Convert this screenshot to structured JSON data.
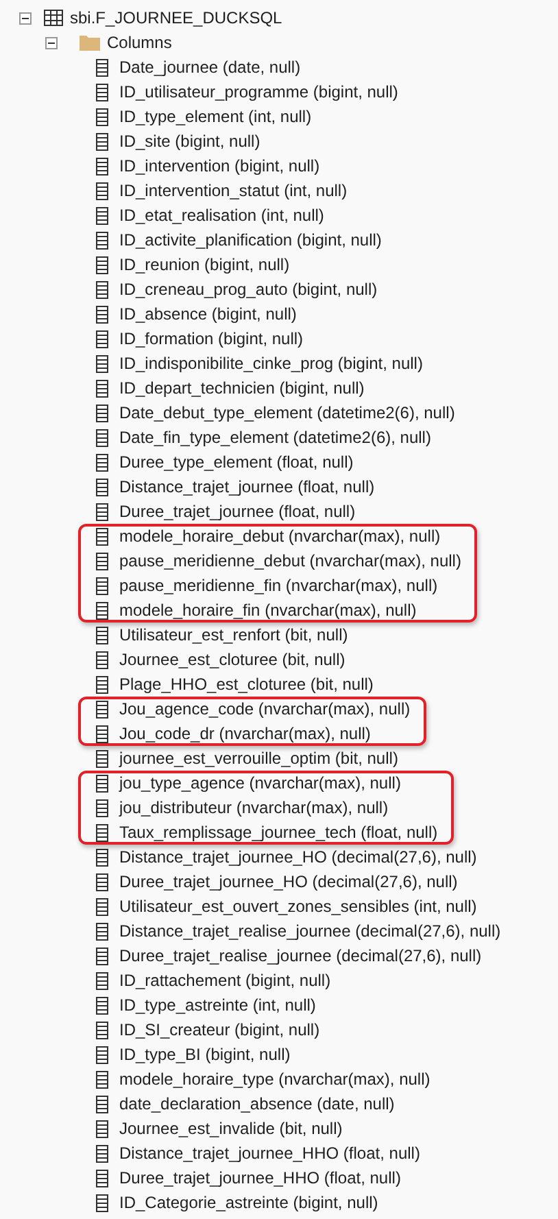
{
  "tree": [
    {
      "label": "sbi.F_JOURNEE_DUCKSQL",
      "kind": "table",
      "expanded": true,
      "children": [
        {
          "label": "Columns",
          "kind": "folder",
          "expanded": true,
          "children": [
            {
              "label": "Date_journee (date, null)",
              "kind": "column",
              "highlighted": false
            },
            {
              "label": "ID_utilisateur_programme (bigint, null)",
              "kind": "column",
              "highlighted": false
            },
            {
              "label": "ID_type_element (int, null)",
              "kind": "column",
              "highlighted": false
            },
            {
              "label": "ID_site (bigint, null)",
              "kind": "column",
              "highlighted": false
            },
            {
              "label": "ID_intervention (bigint, null)",
              "kind": "column",
              "highlighted": false
            },
            {
              "label": "ID_intervention_statut (int, null)",
              "kind": "column",
              "highlighted": false
            },
            {
              "label": "ID_etat_realisation (int, null)",
              "kind": "column",
              "highlighted": false
            },
            {
              "label": "ID_activite_planification (bigint, null)",
              "kind": "column",
              "highlighted": false
            },
            {
              "label": "ID_reunion (bigint, null)",
              "kind": "column",
              "highlighted": false
            },
            {
              "label": "ID_creneau_prog_auto (bigint, null)",
              "kind": "column",
              "highlighted": false
            },
            {
              "label": "ID_absence (bigint, null)",
              "kind": "column",
              "highlighted": false
            },
            {
              "label": "ID_formation (bigint, null)",
              "kind": "column",
              "highlighted": false
            },
            {
              "label": "ID_indisponibilite_cinke_prog (bigint, null)",
              "kind": "column",
              "highlighted": false
            },
            {
              "label": "ID_depart_technicien (bigint, null)",
              "kind": "column",
              "highlighted": false
            },
            {
              "label": "Date_debut_type_element (datetime2(6), null)",
              "kind": "column",
              "highlighted": false
            },
            {
              "label": "Date_fin_type_element (datetime2(6), null)",
              "kind": "column",
              "highlighted": false
            },
            {
              "label": "Duree_type_element (float, null)",
              "kind": "column",
              "highlighted": false
            },
            {
              "label": "Distance_trajet_journee (float, null)",
              "kind": "column",
              "highlighted": false
            },
            {
              "label": "Duree_trajet_journee (float, null)",
              "kind": "column",
              "highlighted": false
            },
            {
              "label": "modele_horaire_debut (nvarchar(max), null)",
              "kind": "column",
              "highlighted": true
            },
            {
              "label": "pause_meridienne_debut (nvarchar(max), null)",
              "kind": "column",
              "highlighted": true
            },
            {
              "label": "pause_meridienne_fin (nvarchar(max), null)",
              "kind": "column",
              "highlighted": true
            },
            {
              "label": "modele_horaire_fin (nvarchar(max), null)",
              "kind": "column",
              "highlighted": true
            },
            {
              "label": "Utilisateur_est_renfort (bit, null)",
              "kind": "column",
              "highlighted": false
            },
            {
              "label": "Journee_est_cloturee (bit, null)",
              "kind": "column",
              "highlighted": false
            },
            {
              "label": "Plage_HHO_est_cloturee (bit, null)",
              "kind": "column",
              "highlighted": false
            },
            {
              "label": "Jou_agence_code (nvarchar(max), null)",
              "kind": "column",
              "highlighted": true
            },
            {
              "label": "Jou_code_dr (nvarchar(max), null)",
              "kind": "column",
              "highlighted": true
            },
            {
              "label": "journee_est_verrouille_optim (bit, null)",
              "kind": "column",
              "highlighted": false
            },
            {
              "label": "jou_type_agence (nvarchar(max), null)",
              "kind": "column",
              "highlighted": true
            },
            {
              "label": "jou_distributeur (nvarchar(max), null)",
              "kind": "column",
              "highlighted": true
            },
            {
              "label": "Taux_remplissage_journee_tech (float, null)",
              "kind": "column",
              "highlighted": true
            },
            {
              "label": "Distance_trajet_journee_HO (decimal(27,6), null)",
              "kind": "column",
              "highlighted": false
            },
            {
              "label": "Duree_trajet_journee_HO (decimal(27,6), null)",
              "kind": "column",
              "highlighted": false
            },
            {
              "label": "Utilisateur_est_ouvert_zones_sensibles (int, null)",
              "kind": "column",
              "highlighted": false
            },
            {
              "label": "Distance_trajet_realise_journee (decimal(27,6), null)",
              "kind": "column",
              "highlighted": false
            },
            {
              "label": "Duree_trajet_realise_journee (decimal(27,6), null)",
              "kind": "column",
              "highlighted": false
            },
            {
              "label": "ID_rattachement (bigint, null)",
              "kind": "column",
              "highlighted": false
            },
            {
              "label": "ID_type_astreinte (int, null)",
              "kind": "column",
              "highlighted": false
            },
            {
              "label": "ID_SI_createur (bigint, null)",
              "kind": "column",
              "highlighted": false
            },
            {
              "label": "ID_type_BI (bigint, null)",
              "kind": "column",
              "highlighted": false
            },
            {
              "label": "modele_horaire_type (nvarchar(max), null)",
              "kind": "column",
              "highlighted": false
            },
            {
              "label": "date_declaration_absence (date, null)",
              "kind": "column",
              "highlighted": false
            },
            {
              "label": "Journee_est_invalide (bit, null)",
              "kind": "column",
              "highlighted": false
            },
            {
              "label": "Distance_trajet_journee_HHO (float, null)",
              "kind": "column",
              "highlighted": false
            },
            {
              "label": "Duree_trajet_journee_HHO (float, null)",
              "kind": "column",
              "highlighted": false
            },
            {
              "label": "ID_Categorie_astreinte (bigint, null)",
              "kind": "column",
              "highlighted": false
            }
          ]
        }
      ]
    }
  ]
}
